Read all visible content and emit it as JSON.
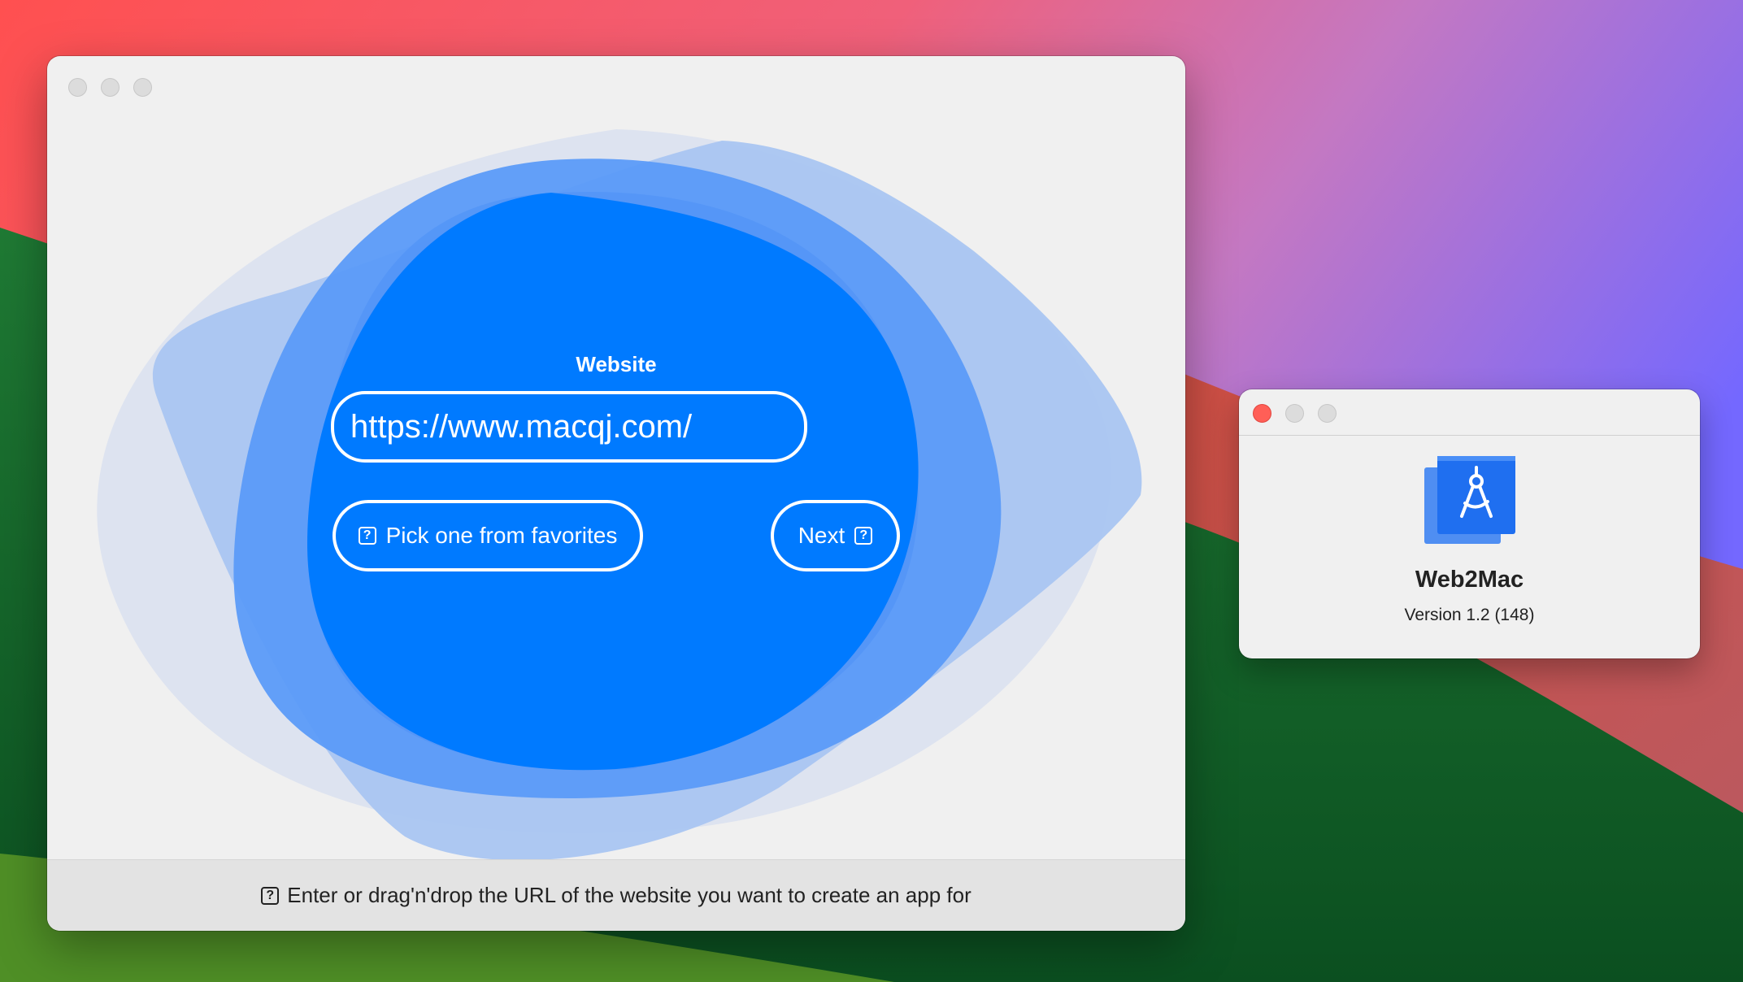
{
  "wizard": {
    "field_title": "Website",
    "url_value": "https://www.macqj.com/",
    "pick_button_label": "Pick one from favorites",
    "next_button_label": "Next",
    "help_glyph": "?",
    "footer_hint": "Enter or drag'n'drop the URL of the website you want to create an app for"
  },
  "about": {
    "app_name": "Web2Mac",
    "version": "Version 1.2 (148)"
  },
  "icons": [
    "question-mark-icon",
    "compass-icon",
    "close-icon"
  ],
  "colors": {
    "accent_blue": "#007aff",
    "close_red": "#ff5f57",
    "window_bg": "#f0f0f0"
  }
}
